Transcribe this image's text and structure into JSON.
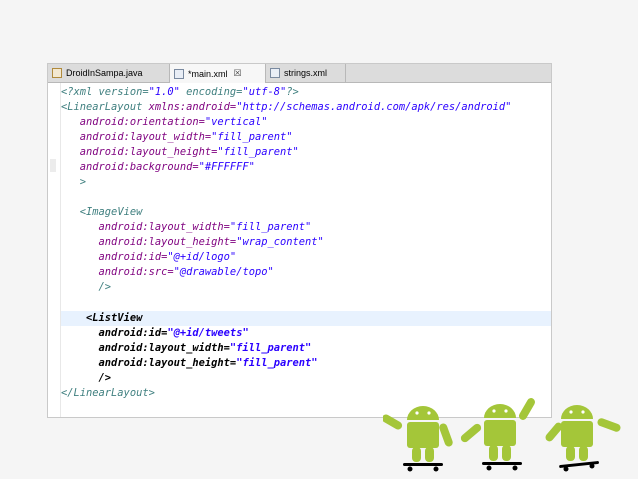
{
  "tabs": [
    {
      "label": "DroidInSampa.java",
      "icon": "java-file-icon",
      "active": false
    },
    {
      "label": "*main.xml",
      "icon": "xml-file-icon",
      "active": true,
      "close": "☒"
    },
    {
      "label": "strings.xml",
      "icon": "xml-file-icon",
      "active": false
    }
  ],
  "code": {
    "l1": {
      "p": "<?xml version=",
      "v1": "\"1.0\"",
      "m": " encoding=",
      "v2": "\"utf-8\"",
      "e": "?>"
    },
    "l2": {
      "t": "<LinearLayout ",
      "a": "xmlns:android=",
      "v": "\"http://schemas.android.com/apk/res/android\""
    },
    "l3": {
      "a": "android:orientation=",
      "v": "\"vertical\""
    },
    "l4": {
      "a": "android:layout_width=",
      "v": "\"fill_parent\""
    },
    "l5": {
      "a": "android:layout_height=",
      "v": "\"fill_parent\""
    },
    "l6": {
      "a": "android:background=",
      "v": "\"#FFFFFF\""
    },
    "l7": {
      "t": ">"
    },
    "l8": {
      "t": "<ImageView"
    },
    "l9": {
      "a": "android:layout_width=",
      "v": "\"fill_parent\""
    },
    "l10": {
      "a": "android:layout_height=",
      "v": "\"wrap_content\""
    },
    "l11": {
      "a": "android:id=",
      "v": "\"@+id/logo\""
    },
    "l12": {
      "a": "android:src=",
      "v": "\"@drawable/topo\""
    },
    "l13": {
      "t": "/>"
    },
    "l14": {
      "t": "<ListView"
    },
    "l15": {
      "a": "android:id=",
      "v": "\"@+id/tweets\""
    },
    "l16": {
      "a": "android:layout_width=",
      "v": "\"fill_parent\""
    },
    "l17": {
      "a": "android:layout_height=",
      "v": "\"fill_parent\""
    },
    "l18": {
      "t": "/>"
    },
    "l19": {
      "t": "</LinearLayout>"
    }
  },
  "colors": {
    "tag": "#3f7f7f",
    "attribute": "#7f007f",
    "value": "#2a00ff",
    "current_line": "#e8f2fe",
    "android_green": "#a4c639"
  },
  "decoration": {
    "icon": "skateboarding-android-robots-icon",
    "count": 3
  }
}
